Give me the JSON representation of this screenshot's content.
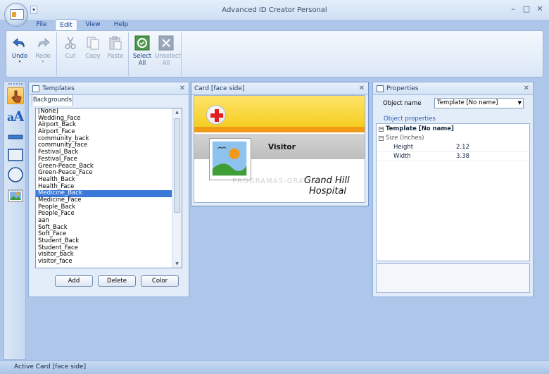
{
  "window": {
    "title": "Advanced ID Creator Personal"
  },
  "menu_tabs": [
    "File",
    "Edit",
    "View",
    "Help"
  ],
  "ribbon": {
    "undo": "Undo",
    "redo": "Redo",
    "cut": "Cut",
    "copy": "Copy",
    "paste": "Paste",
    "select_all": [
      "Select",
      "All"
    ],
    "unselect_all": [
      "Unselect",
      "All"
    ]
  },
  "templates_panel": {
    "title": "Templates",
    "subtab": "Backgrounds",
    "items": [
      "[None]",
      "Wedding_Face",
      "Airport_Back",
      "Airport_Face",
      "community_back",
      "community_face",
      "Festival_Back",
      "Festival_Face",
      "Green-Peace_Back",
      "Green-Peace_Face",
      "Health_Back",
      "Health_Face",
      "Medicine_Back",
      "Medicine_Face",
      "People_Back",
      "People_Face",
      "aan",
      "Soft_Back",
      "Soft_Face",
      "Student_Back",
      "Student_Face",
      "visitor_back",
      "visitor_face"
    ],
    "selected": "Medicine_Back",
    "buttons": {
      "add": "Add",
      "delete": "Delete",
      "color": "Color"
    }
  },
  "card_panel": {
    "title": "Card [face side]",
    "visitor": "Visitor",
    "line1": "Grand Hill",
    "line2": "Hospital",
    "watermark": "PROGRAMAS-GRATIS"
  },
  "properties_panel": {
    "title": "Properties",
    "object_name_label": "Object name",
    "object_name_value": "Template [No name]",
    "object_properties": "Object properties",
    "root": "Template [No name]",
    "group": "Size (Inches)",
    "rows": [
      {
        "key": "Height",
        "value": "2.12"
      },
      {
        "key": "Width",
        "value": "3.38"
      }
    ]
  },
  "status": "Active Card [face side]",
  "colors": {
    "accent": "#3a79d8",
    "ribbon_text": "#15428b",
    "card_yellow": "#f5ce21",
    "card_orange": "#f09a18"
  }
}
